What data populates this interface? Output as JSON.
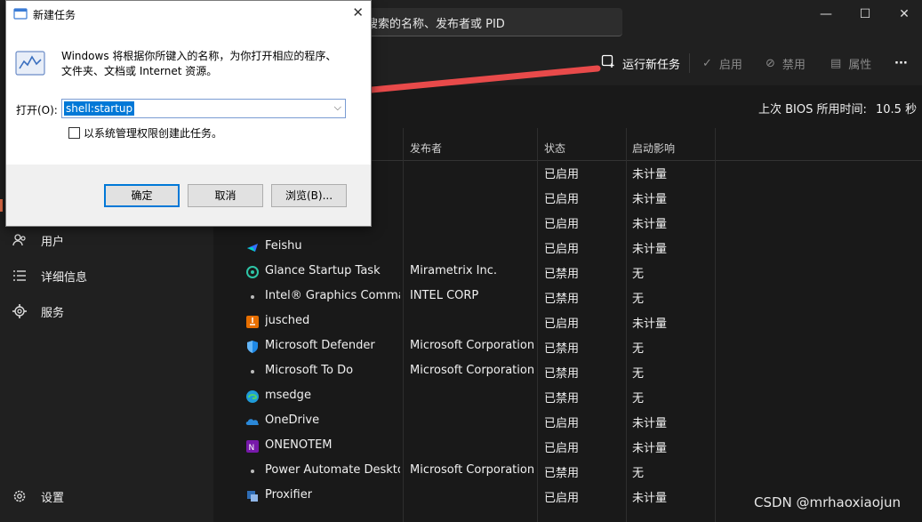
{
  "titlebar": {
    "search_text": "搜索的名称、发布者或 PID",
    "min_icon": "minimize-icon",
    "max_icon": "maximize-icon",
    "close_icon": "close-icon"
  },
  "sidebar": {
    "items": [
      {
        "label": "用户",
        "icon": "users-icon"
      },
      {
        "label": "详细信息",
        "icon": "list-icon"
      },
      {
        "label": "服务",
        "icon": "puzzle-icon"
      }
    ],
    "settings_label": "设置"
  },
  "commandbar": {
    "run_new_task": "运行新任务",
    "enable": "启用",
    "disable": "禁用",
    "properties": "属性",
    "more": "···"
  },
  "bios": {
    "label": "上次 BIOS 所用时间:",
    "value": "10.5 秒"
  },
  "table": {
    "columns": [
      "发布者",
      "状态",
      "启动影响"
    ],
    "rows": [
      {
        "name": "",
        "publisher": "",
        "state": "已启用",
        "impact": "未计量",
        "icon": ""
      },
      {
        "name": "",
        "publisher": "",
        "state": "已启用",
        "impact": "未计量",
        "icon": ""
      },
      {
        "name": "",
        "publisher": "",
        "state": "已启用",
        "impact": "未计量",
        "icon": ""
      },
      {
        "name": "Feishu",
        "publisher": "",
        "state": "已启用",
        "impact": "未计量",
        "icon": "feishu-icon"
      },
      {
        "name": "Glance Startup Task",
        "publisher": "Mirametrix Inc.",
        "state": "已禁用",
        "impact": "无",
        "icon": "glance-icon"
      },
      {
        "name": "Intel® Graphics Comma...",
        "publisher": "INTEL CORP",
        "state": "已禁用",
        "impact": "无",
        "icon": "intel-icon"
      },
      {
        "name": "jusched",
        "publisher": "",
        "state": "已启用",
        "impact": "未计量",
        "icon": "java-icon"
      },
      {
        "name": "Microsoft Defender",
        "publisher": "Microsoft Corporation",
        "state": "已禁用",
        "impact": "无",
        "icon": "shield-icon"
      },
      {
        "name": "Microsoft To Do",
        "publisher": "Microsoft Corporation",
        "state": "已禁用",
        "impact": "无",
        "icon": "todo-icon"
      },
      {
        "name": "msedge",
        "publisher": "",
        "state": "已禁用",
        "impact": "无",
        "icon": "edge-icon"
      },
      {
        "name": "OneDrive",
        "publisher": "",
        "state": "已启用",
        "impact": "未计量",
        "icon": "cloud-icon"
      },
      {
        "name": "ONENOTEM",
        "publisher": "",
        "state": "已启用",
        "impact": "未计量",
        "icon": "onenote-icon"
      },
      {
        "name": "Power Automate Desktop",
        "publisher": "Microsoft Corporation",
        "state": "已禁用",
        "impact": "无",
        "icon": "power-automate-icon"
      },
      {
        "name": "Proxifier",
        "publisher": "",
        "state": "已启用",
        "impact": "未计量",
        "icon": "proxifier-icon"
      }
    ]
  },
  "watermark": "CSDN @mrhaoxiaojun",
  "dialog": {
    "title": "新建任务",
    "close": "✕",
    "description": "Windows 将根据你所键入的名称，为你打开相应的程序、文件夹、文档或 Internet 资源。",
    "open_label": "打开(O):",
    "input_value": "shell:startup",
    "checkbox_label": "以系统管理权限创建此任务。",
    "ok": "确定",
    "cancel": "取消",
    "browse": "浏览(B)..."
  },
  "colors": {
    "arrow": "#e84a4a",
    "selection": "#0078d7",
    "dark_bg": "#202020"
  }
}
